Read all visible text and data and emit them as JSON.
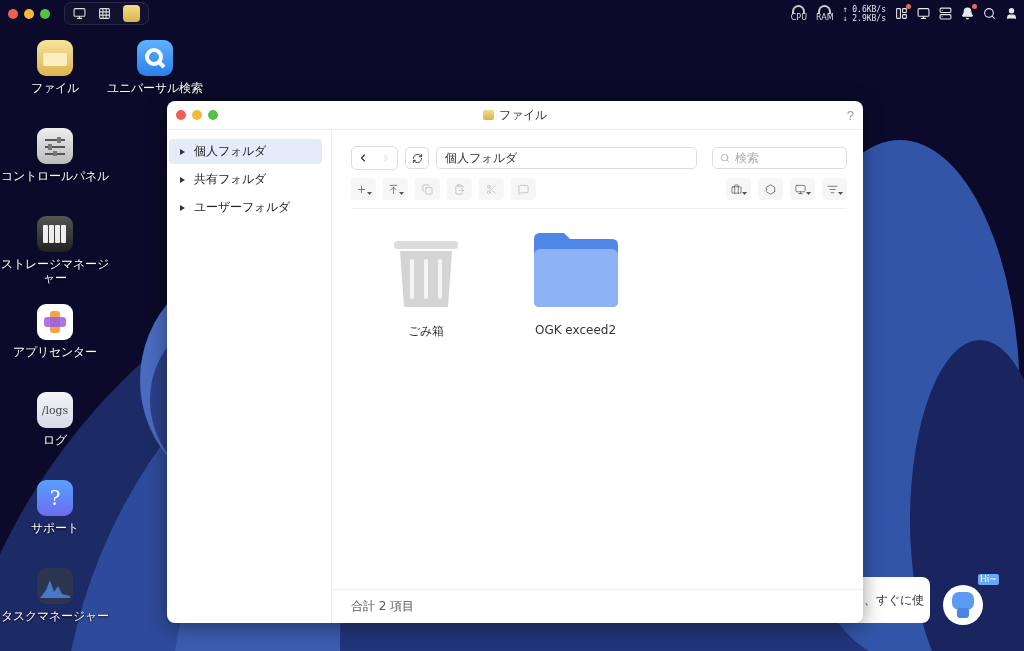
{
  "top_bar": {
    "apps": [
      {
        "kind": "desktop"
      },
      {
        "kind": "grid"
      },
      {
        "kind": "files"
      }
    ],
    "gauges": [
      {
        "label": "CPU"
      },
      {
        "label": "RAM"
      }
    ],
    "upload": "↑ 0.6KB/s",
    "download": "↓ 2.9KB/s",
    "status_icons": [
      {
        "kind": "panel",
        "badge": true
      },
      {
        "kind": "monitor",
        "badge": false
      },
      {
        "kind": "server",
        "badge": false
      },
      {
        "kind": "bell",
        "badge": true
      },
      {
        "kind": "search",
        "badge": false
      },
      {
        "kind": "user",
        "badge": false
      }
    ]
  },
  "desktop_icons": [
    {
      "label": "ファイル",
      "kind": "files"
    },
    {
      "label": "コントロールパネル",
      "kind": "control"
    },
    {
      "label": "ストレージマネージャー",
      "kind": "storage"
    },
    {
      "label": "アプリセンター",
      "kind": "apps"
    },
    {
      "label": "ログ",
      "kind": "logs",
      "glyph": "/logs"
    },
    {
      "label": "サポート",
      "kind": "support",
      "glyph": "?"
    },
    {
      "label": "タスクマネージャー",
      "kind": "tasks"
    }
  ],
  "desktop_icons_2": [
    {
      "label": "ユニバーサル検索",
      "kind": "search"
    }
  ],
  "window": {
    "title": "ファイル",
    "help": "?",
    "sidebar": [
      {
        "label": "個人フォルダ",
        "selected": true
      },
      {
        "label": "共有フォルダ",
        "selected": false
      },
      {
        "label": "ユーザーフォルダ",
        "selected": false
      }
    ],
    "nav": [
      {
        "kind": "back",
        "disabled": false
      },
      {
        "kind": "forward",
        "disabled": true
      }
    ],
    "path": "個人フォルダ",
    "search": {
      "placeholder": "検索"
    },
    "tools_left": [
      {
        "kind": "new",
        "disabled": false
      },
      {
        "kind": "upload",
        "disabled": false
      },
      {
        "kind": "copy",
        "disabled": true
      },
      {
        "kind": "paste",
        "disabled": true
      },
      {
        "kind": "cut",
        "disabled": true
      },
      {
        "kind": "share",
        "disabled": true
      }
    ],
    "tools_right": [
      {
        "kind": "briefcase",
        "disabled": false
      },
      {
        "kind": "settings",
        "disabled": false
      },
      {
        "kind": "view",
        "disabled": false
      },
      {
        "kind": "sort",
        "disabled": false
      }
    ],
    "files": [
      {
        "name": "ごみ箱",
        "kind": "trash"
      },
      {
        "name": "OGK exceed2",
        "kind": "folder"
      }
    ],
    "status": "合計 2 項目"
  },
  "assistant": {
    "bubble": "、すぐに使",
    "badge": "Hi~"
  }
}
